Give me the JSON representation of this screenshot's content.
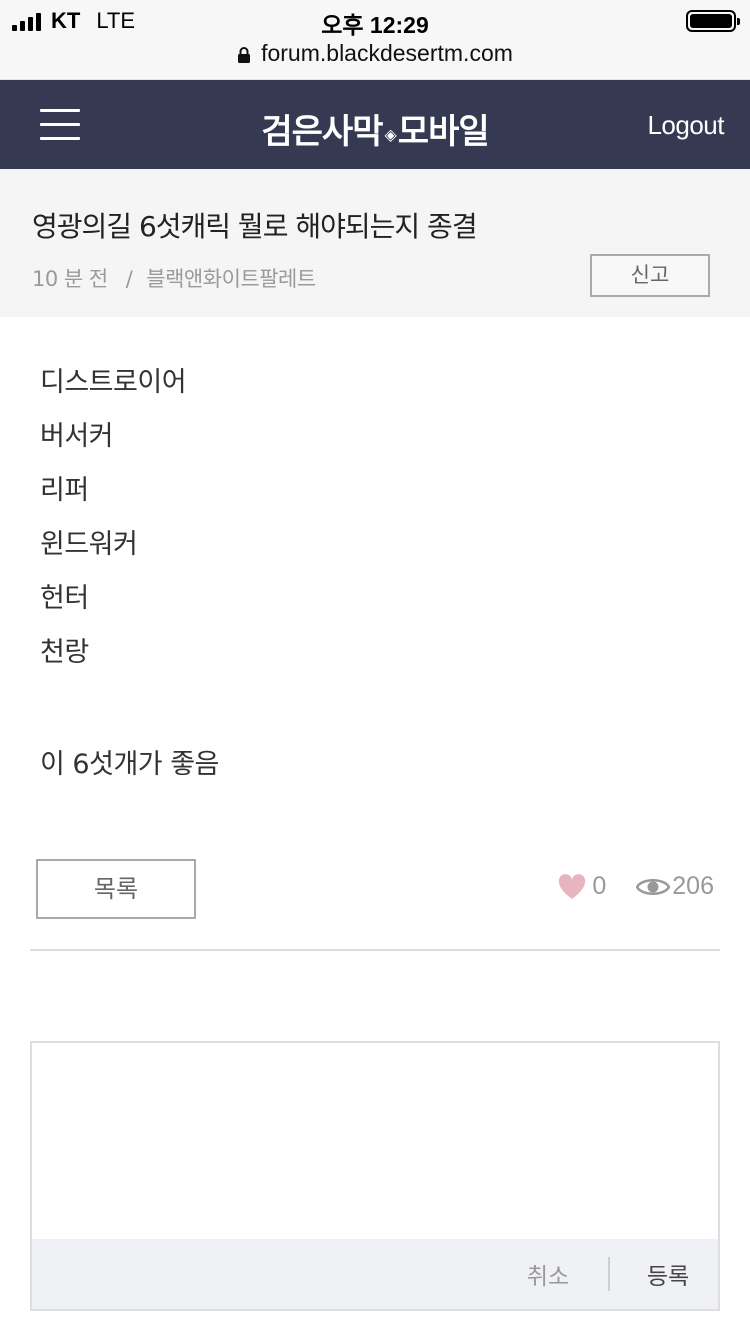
{
  "status_bar": {
    "carrier": "KT",
    "network": "LTE",
    "time": "오후 12:29",
    "url": "forum.blackdesertm.com"
  },
  "header": {
    "brand_left": "검은사막",
    "brand_right": "모바일",
    "logout_label": "Logout",
    "background_color": "#353a52"
  },
  "post": {
    "title": "영광의길 6섯캐릭 뭘로 해야되는지 종결",
    "time_ago": "10 분 전",
    "meta_separator": "/",
    "author": "블랙앤화이트팔레트",
    "report_label": "신고",
    "body_lines": [
      "디스트로이어",
      "버서커",
      "리퍼",
      "윈드워커",
      "헌터",
      "천랑"
    ],
    "closing_line": "이 6섯개가 좋음"
  },
  "actions": {
    "list_label": "목록",
    "likes": "0",
    "views": "206",
    "heart_color": "#e8b4bf"
  },
  "comment": {
    "placeholder": "",
    "cancel_label": "취소",
    "submit_label": "등록"
  }
}
